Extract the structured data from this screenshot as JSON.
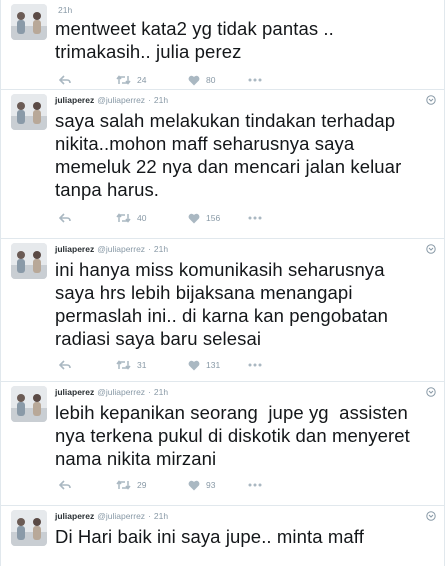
{
  "colors": {
    "text": "#14171a",
    "meta": "#8899a6",
    "border": "#e1e8ed",
    "icon": "#aab8c2"
  },
  "icons": {
    "avatar": "profile-photo",
    "reply": "reply-arrow",
    "retweet": "retweet-arrows",
    "like": "heart",
    "more": "ellipsis",
    "caret": "chevron-down"
  },
  "tweets": [
    {
      "name": "",
      "handle": "",
      "time": "21h",
      "text": "mentweet kata2 yg tidak pantas ..\ntrimakasih.. julia perez",
      "retweets": "24",
      "likes": "80"
    },
    {
      "name": "juliaperez",
      "handle": "@juliaperrez",
      "time": "21h",
      "text": "saya salah melakukan tindakan terhadap\nnikita..mohon maff seharusnya saya\nmemeluk 22 nya dan mencari jalan keluar\ntanpa harus.",
      "retweets": "40",
      "likes": "156"
    },
    {
      "name": "juliaperez",
      "handle": "@juliaperrez",
      "time": "21h",
      "text": "ini hanya miss komunikasih seharusnya\nsaya hrs lebih bijaksana menangapi\npermaslah ini.. di karna kan pengobatan\nradiasi saya baru selesai",
      "retweets": "31",
      "likes": "131"
    },
    {
      "name": "juliaperez",
      "handle": "@juliaperrez",
      "time": "21h",
      "text": "lebih kepanikan seorang  jupe yg  assisten\nnya terkena pukul di diskotik dan menyeret\nnama nikita mirzani",
      "retweets": "29",
      "likes": "93"
    },
    {
      "name": "juliaperez",
      "handle": "@juliaperrez",
      "time": "21h",
      "text": "Di Hari baik ini saya jupe.. minta maff",
      "retweets": "",
      "likes": ""
    }
  ]
}
